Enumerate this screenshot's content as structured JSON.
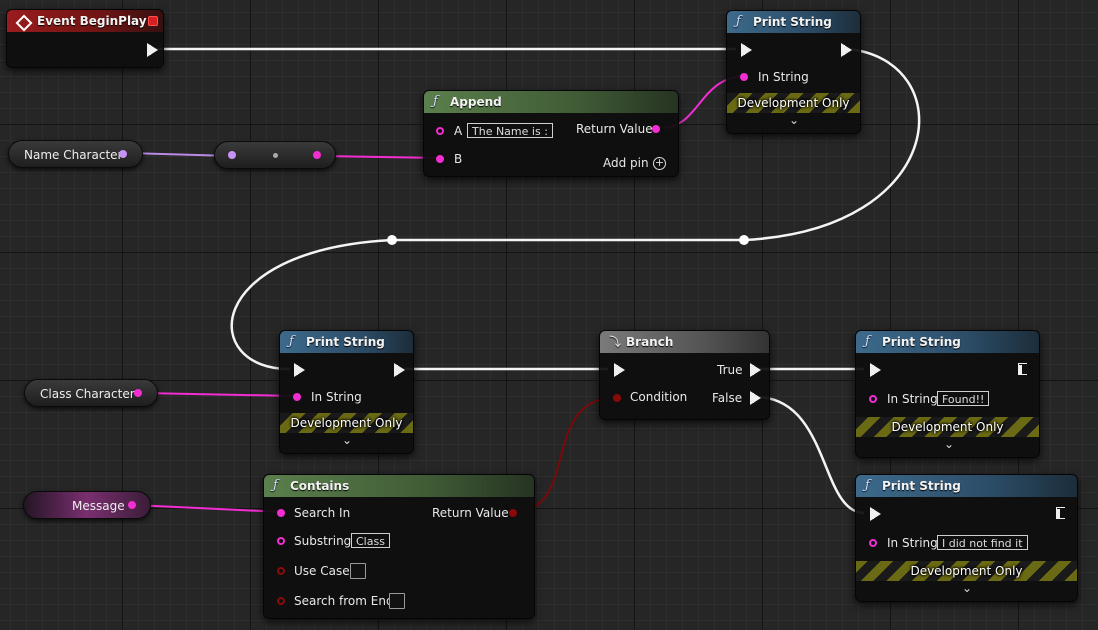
{
  "nodes": {
    "event_begin_play": {
      "title": "Event BeginPlay"
    },
    "print_string_1": {
      "title": "Print String",
      "in_string_label": "In String",
      "dev_label": "Development Only"
    },
    "append": {
      "title": "Append",
      "pin_a_label": "A",
      "pin_a_value": "The Name is :",
      "pin_b_label": "B",
      "return_label": "Return Value",
      "add_pin_label": "Add pin"
    },
    "print_string_2": {
      "title": "Print String",
      "in_string_label": "In String",
      "dev_label": "Development Only"
    },
    "branch": {
      "title": "Branch",
      "condition_label": "Condition",
      "true_label": "True",
      "false_label": "False"
    },
    "print_string_found": {
      "title": "Print String",
      "in_string_label": "In String",
      "in_string_value": "Found!!",
      "dev_label": "Development Only"
    },
    "print_string_not_found": {
      "title": "Print String",
      "in_string_label": "In String",
      "in_string_value": "I did not find it",
      "dev_label": "Development Only"
    },
    "contains": {
      "title": "Contains",
      "search_in_label": "Search In",
      "return_label": "Return Value",
      "substring_label": "Substring",
      "substring_value": "Class",
      "use_case_label": "Use Case",
      "search_from_end_label": "Search from End"
    }
  },
  "variables": {
    "name_character": "Name Character",
    "class_character": "Class Character",
    "message": "Message"
  },
  "colors": {
    "exec_wire": "#ffffff",
    "string_wire": "#f22dd2",
    "name_wire": "#c792f5",
    "bool_wire": "#8a0a0a",
    "event_header": "#9a1c1c",
    "function_header": "#3d6a8c",
    "pure_header": "#5b7f4c"
  }
}
